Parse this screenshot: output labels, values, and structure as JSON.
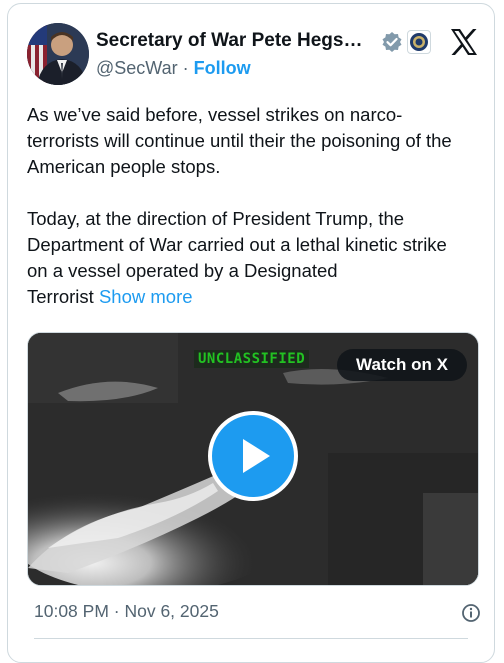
{
  "author": {
    "name": "Secretary of War Pete Hegs…",
    "handle": "@SecWar",
    "separator": "·",
    "follow_label": "Follow"
  },
  "tweet": {
    "paragraph1_line1": "As we’ve said before, vessel strikes on narco-",
    "paragraph1_line2": "terrorists will continue until their the poisoning of the",
    "paragraph1_line3": "American people stops.",
    "paragraph2_line1": "Today, at the direction of President Trump, the",
    "paragraph2_line2": "Department of War carried out a lethal kinetic strike",
    "paragraph2_line3": "on a vessel operated by a Designated",
    "paragraph2_line4": "Terrorist",
    "show_more_label": "Show more"
  },
  "media": {
    "overlay_label": "UNCLASSIFIED",
    "watch_label": "Watch on X"
  },
  "timestamp": "10:08 PM · Nov 6, 2025",
  "colors": {
    "accent": "#1d9bf0",
    "text": "#0f1419",
    "secondary_text": "#536471",
    "border": "#cfd9de",
    "overlay_green": "#22c222"
  },
  "icons": {
    "verified": "verified-badge-icon",
    "affiliation": "government-seal-icon",
    "platform": "x-logo-icon",
    "play": "play-icon",
    "info": "info-icon"
  }
}
